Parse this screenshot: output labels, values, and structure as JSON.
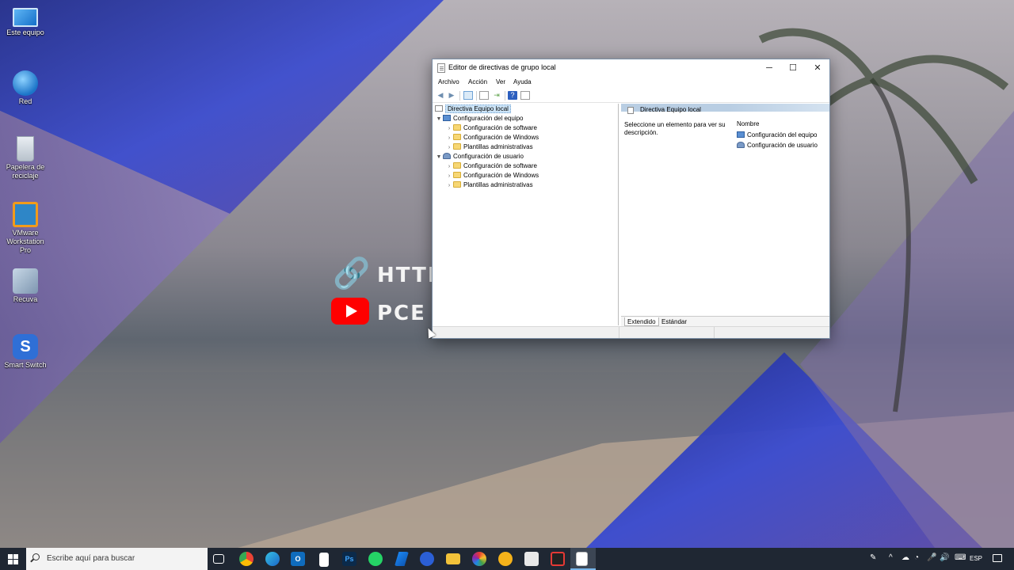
{
  "wallpaper": {
    "line1": "HTTI",
    "line2": "PCE",
    "link_icon": "link-icon",
    "video_icon": "play-icon"
  },
  "desktop": {
    "icons": [
      {
        "label": "Este equipo",
        "icon": "computer-icon"
      },
      {
        "label": "Red",
        "icon": "network-icon"
      },
      {
        "label": "Papelera de reciclaje",
        "icon": "recycle-bin-icon"
      },
      {
        "label": "VMware Workstation Pro",
        "icon": "vmware-icon"
      },
      {
        "label": "Recuva",
        "icon": "recuva-icon"
      },
      {
        "label": "Smart Switch",
        "icon": "smart-switch-icon"
      }
    ]
  },
  "window": {
    "title": "Editor de directivas de grupo local",
    "controls": {
      "minimize": "─",
      "maximize": "☐",
      "close": "✕"
    },
    "menu": [
      "Archivo",
      "Acción",
      "Ver",
      "Ayuda"
    ],
    "tree": {
      "root": "Directiva Equipo local",
      "computer": {
        "label": "Configuración del equipo",
        "children": [
          "Configuración de software",
          "Configuración de Windows",
          "Plantillas administrativas"
        ]
      },
      "user": {
        "label": "Configuración de usuario",
        "children": [
          "Configuración de software",
          "Configuración de Windows",
          "Plantillas administrativas"
        ]
      }
    },
    "details": {
      "header": "Directiva Equipo local",
      "description": "Seleccione un elemento para ver su descripción.",
      "column": "Nombre",
      "items": [
        "Configuración del equipo",
        "Configuración de usuario"
      ]
    },
    "tabs": [
      "Extendido",
      "Estándar"
    ]
  },
  "taskbar": {
    "search_placeholder": "Escribe aquí para buscar",
    "language": "ESP",
    "colors": {
      "background": "#1f2733",
      "accent": "#78b6ea"
    }
  }
}
